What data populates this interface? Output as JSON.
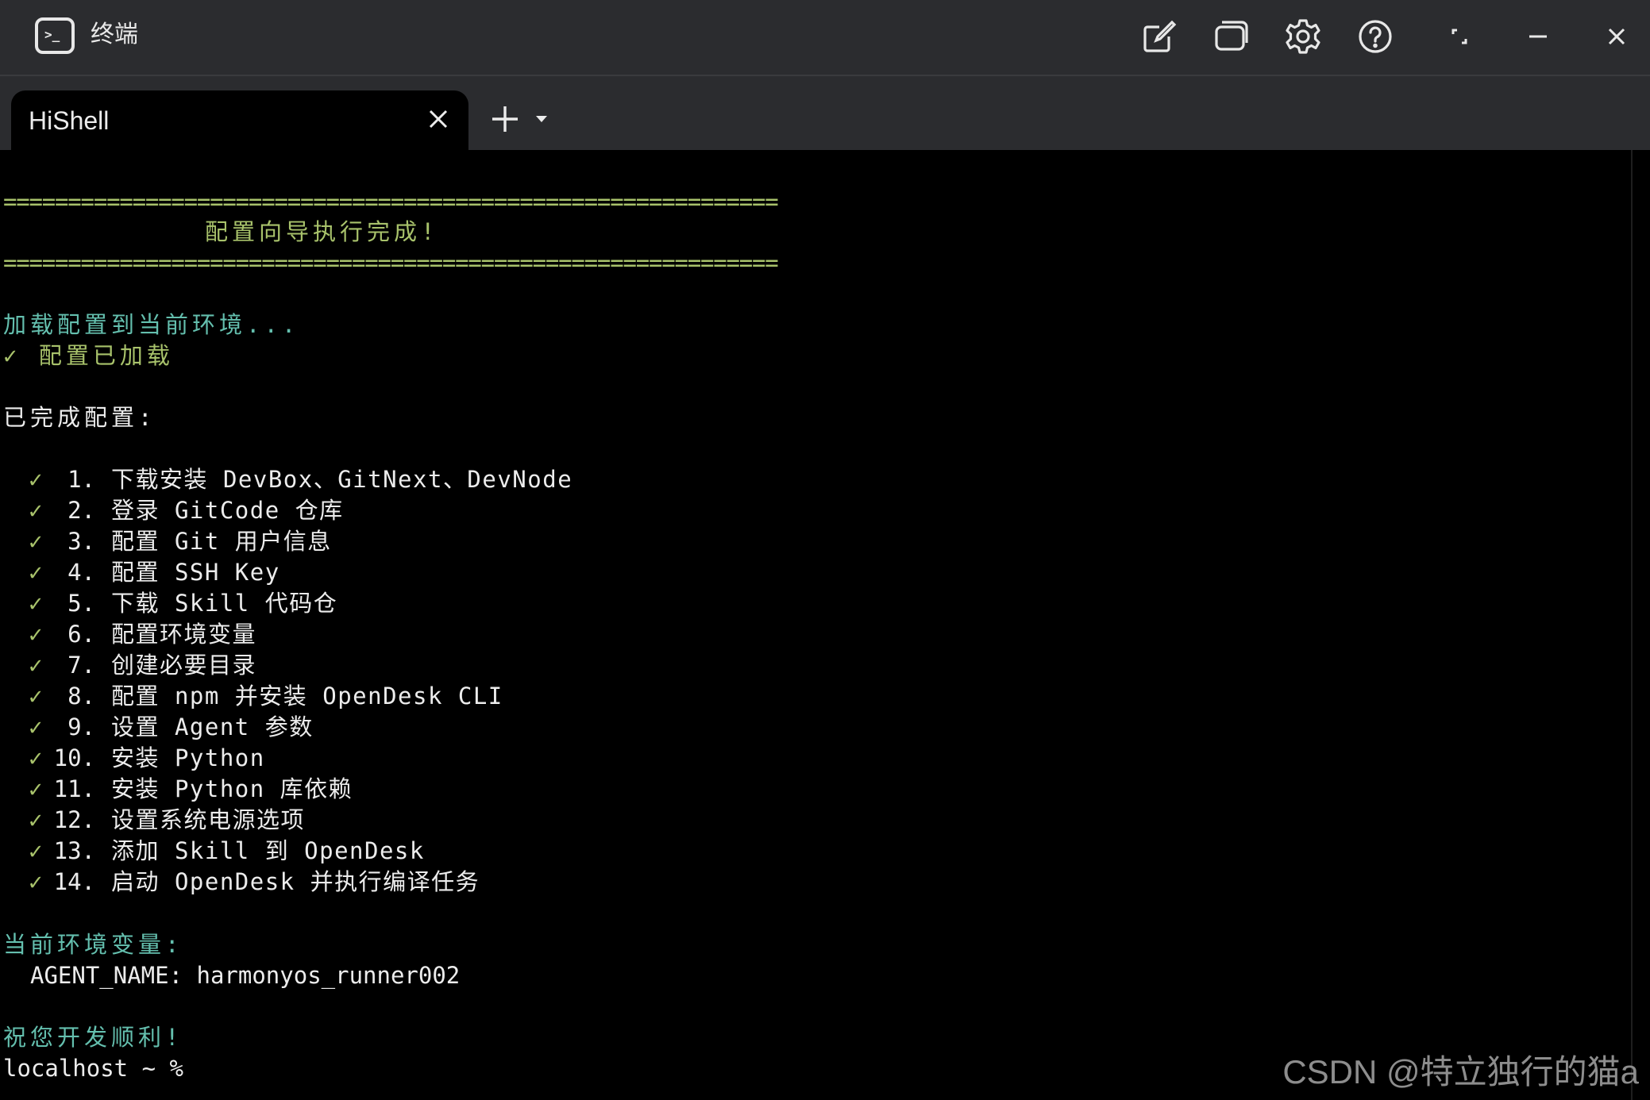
{
  "window": {
    "title": "终端",
    "app_icon_glyph": ">_",
    "buttons": [
      "edit-icon",
      "new-window-icon",
      "settings-icon",
      "help-icon",
      "restore-icon",
      "minimize-icon",
      "close-icon"
    ]
  },
  "tabs": [
    {
      "label": "HiShell",
      "active": true
    }
  ],
  "terminal": {
    "rule_top": "============================================================",
    "header": "配置向导执行完成!",
    "rule_bottom": "============================================================",
    "loading": "加载配置到当前环境...",
    "loaded": "✓ 配置已加载",
    "done_heading": "已完成配置:",
    "items": [
      {
        "num": "1.",
        "text": "下载安装 DevBox、GitNext、DevNode"
      },
      {
        "num": "2.",
        "text": "登录 GitCode 仓库"
      },
      {
        "num": "3.",
        "text": "配置 Git 用户信息"
      },
      {
        "num": "4.",
        "text": "配置 SSH Key"
      },
      {
        "num": "5.",
        "text": "下载 Skill 代码仓"
      },
      {
        "num": "6.",
        "text": "配置环境变量"
      },
      {
        "num": "7.",
        "text": "创建必要目录"
      },
      {
        "num": "8.",
        "text": "配置 npm 并安装 OpenDesk CLI"
      },
      {
        "num": "9.",
        "text": "设置 Agent 参数"
      },
      {
        "num": "10.",
        "text": "安装 Python"
      },
      {
        "num": "11.",
        "text": "安装 Python 库依赖"
      },
      {
        "num": "12.",
        "text": "设置系统电源选项"
      },
      {
        "num": "13.",
        "text": "添加 Skill 到 OpenDesk"
      },
      {
        "num": "14.",
        "text": "启动 OpenDesk 并执行编译任务"
      }
    ],
    "check_mark": "✓",
    "env_heading": "当前环境变量:",
    "env_line": "AGENT_NAME: harmonyos_runner002",
    "farewell": "祝您开发顺利!",
    "prompt": "localhost ~ %"
  },
  "watermark": "CSDN @特立独行的猫a",
  "colors": {
    "titlebar": "#2b2c2f",
    "terminal_bg": "#000000",
    "green": "#a8c26b",
    "teal": "#64bfae",
    "text": "#ececec"
  }
}
